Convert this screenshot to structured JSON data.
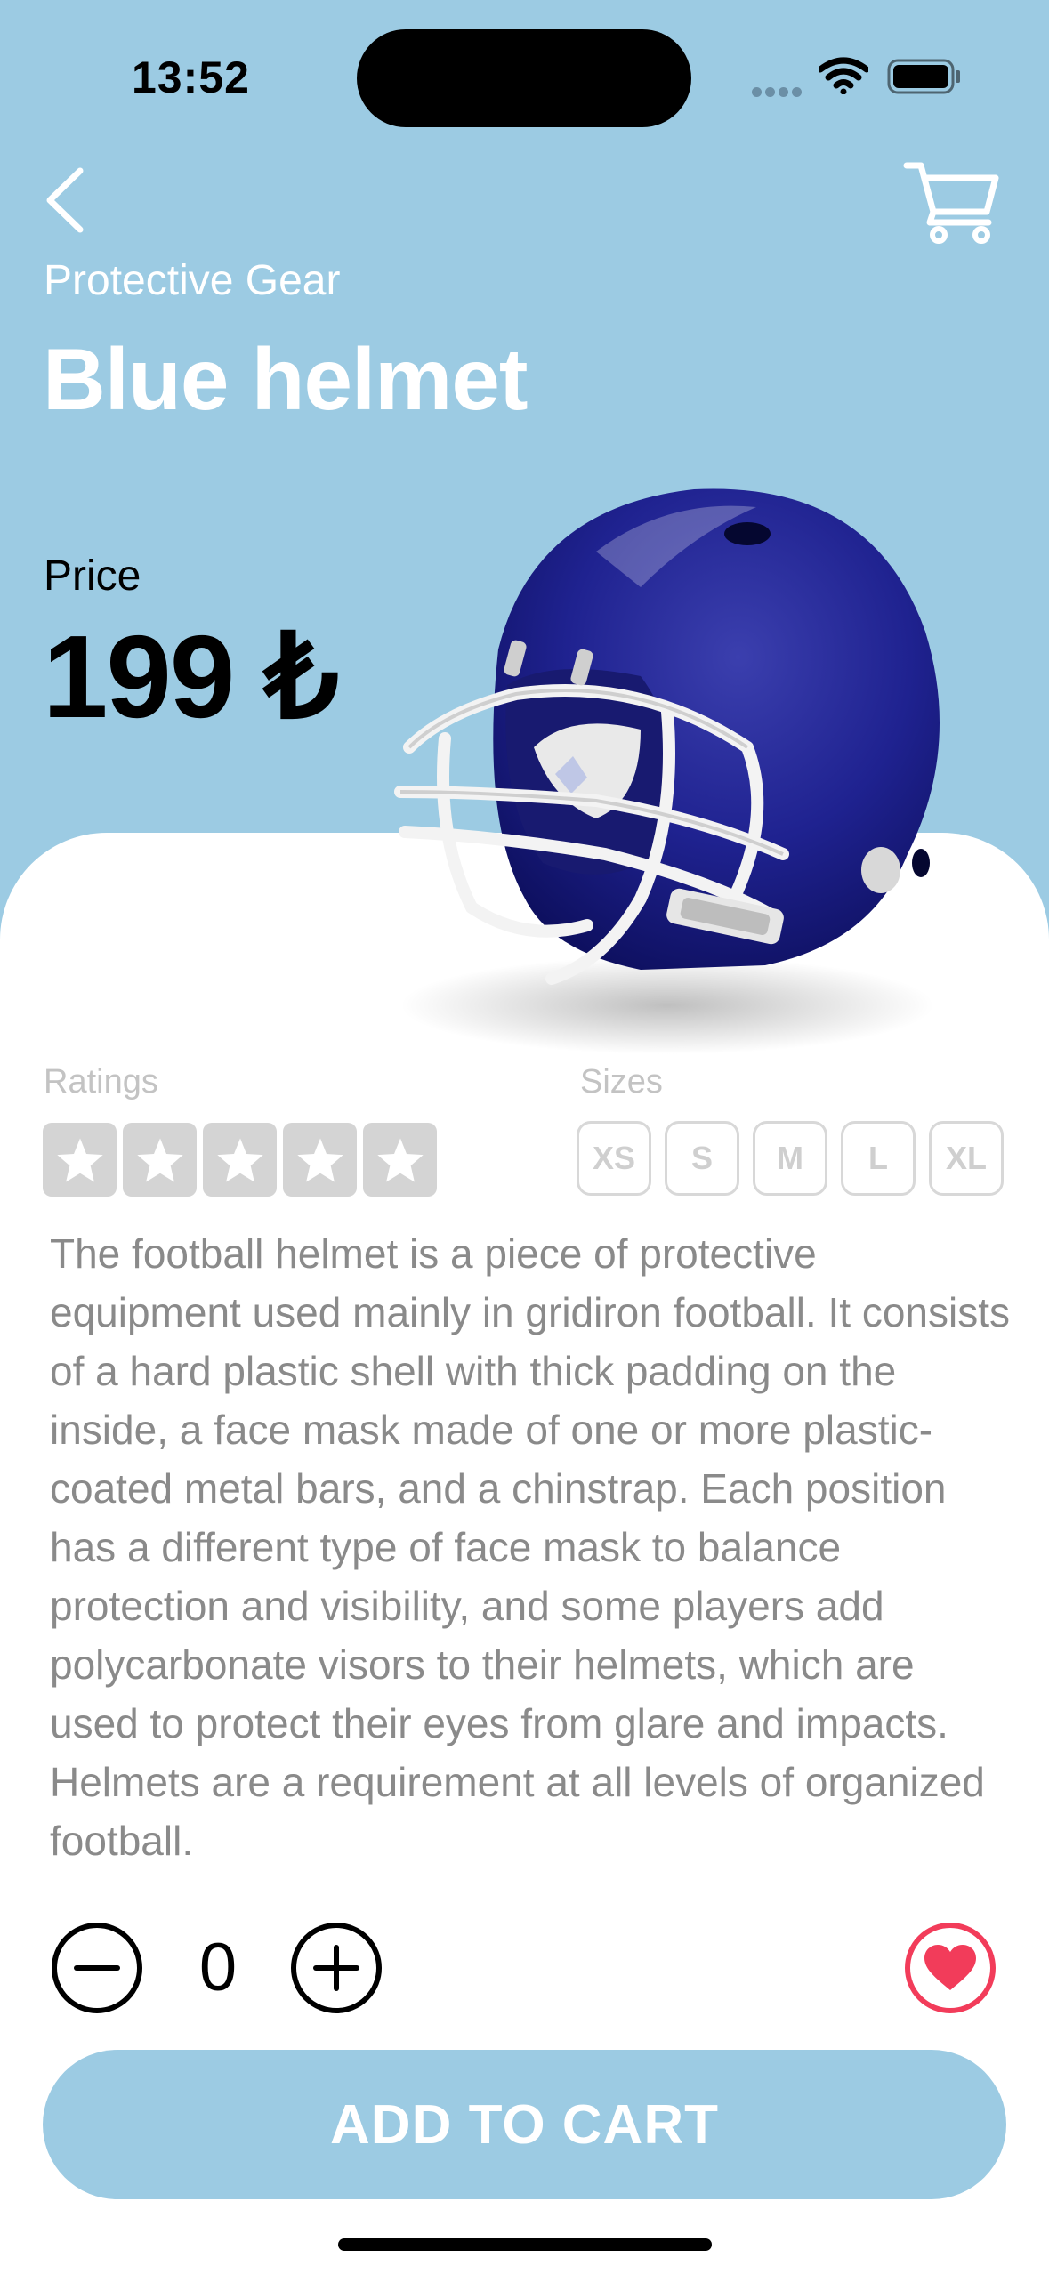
{
  "status_bar": {
    "time": "13:52"
  },
  "header": {
    "back_icon": "chevron-left-icon",
    "cart_icon": "cart-icon"
  },
  "product": {
    "category": "Protective Gear",
    "name": "Blue helmet",
    "price_label": "Price",
    "price": "199 ₺",
    "image": "blue-football-helmet"
  },
  "ratings": {
    "label": "Ratings",
    "rating": 0,
    "max": 5
  },
  "sizes": {
    "label": "Sizes",
    "options": [
      "XS",
      "S",
      "M",
      "L",
      "XL"
    ]
  },
  "description": "The football helmet is a piece of protective equipment used mainly in gridiron football. It consists of a hard plastic shell with thick padding on the inside, a face mask made of one or more plastic-coated metal bars, and a chinstrap. Each position has a different type of face mask to balance protection and visibility, and some players add polycarbonate visors to their helmets, which are used to protect their eyes from glare and impacts. Helmets are a requirement at all levels of organized football.",
  "quantity": {
    "value": "0"
  },
  "actions": {
    "add_to_cart": "ADD TO CART"
  },
  "colors": {
    "background": "#9ccbe3",
    "favorite": "#f23c5a",
    "muted_text": "#8a8a8a",
    "star_bg": "#d4d4d4"
  }
}
